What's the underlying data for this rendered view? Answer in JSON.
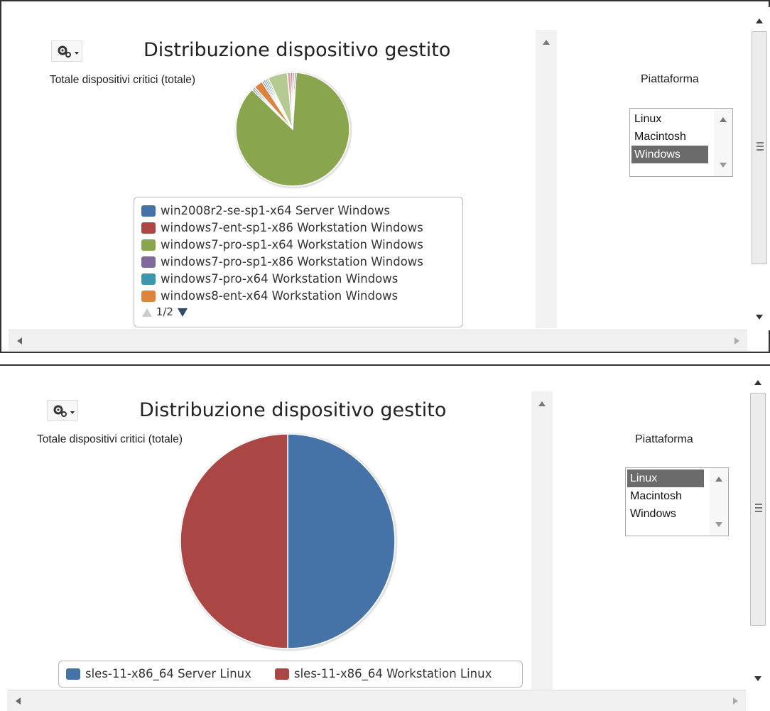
{
  "colors": {
    "blue": "#4572a7",
    "red": "#aa4643",
    "green": "#89a54e",
    "purple": "#80699b",
    "teal": "#3d96ae",
    "orange": "#db843d",
    "light_green": "#b5ca92",
    "light_red": "#d9a3a1",
    "selected_bg": "#6b6b6b"
  },
  "panels": [
    {
      "gear_icon": "gear-icon",
      "title": "Distribuzione dispositivo gestito",
      "subtitle": "Totale dispositivi critici (totale)",
      "legend": {
        "items": [
          {
            "label": "win2008r2-se-sp1-x64 Server Windows",
            "color": "#4572a7"
          },
          {
            "label": "windows7-ent-sp1-x86 Workstation Windows",
            "color": "#aa4643"
          },
          {
            "label": "windows7-pro-sp1-x64 Workstation Windows",
            "color": "#89a54e"
          },
          {
            "label": "windows7-pro-sp1-x86 Workstation Windows",
            "color": "#80699b"
          },
          {
            "label": "windows7-pro-x64 Workstation Windows",
            "color": "#3d96ae"
          },
          {
            "label": "windows8-ent-x64 Workstation Windows",
            "color": "#db843d"
          }
        ],
        "page": "1/2"
      },
      "platform_label": "Piattaforma",
      "platform_options": [
        "Linux",
        "Macintosh",
        "Windows"
      ],
      "platform_selected": "Windows"
    },
    {
      "gear_icon": "gear-icon",
      "title": "Distribuzione dispositivo gestito",
      "subtitle": "Totale dispositivi critici (totale)",
      "legend": {
        "items": [
          {
            "label": "sles-11-x86_64 Server Linux",
            "color": "#4572a7"
          },
          {
            "label": "sles-11-x86_64 Workstation Linux",
            "color": "#aa4643"
          }
        ]
      },
      "platform_label": "Piattaforma",
      "platform_options": [
        "Linux",
        "Macintosh",
        "Windows"
      ],
      "platform_selected": "Linux"
    }
  ],
  "chart_data": [
    {
      "type": "pie",
      "title": "Distribuzione dispositivo gestito",
      "subtitle": "Totale dispositivi critici (totale)",
      "slices": [
        {
          "label": "win2008r2-se-sp1-x64 Server Windows",
          "value": 0.5,
          "color": "#4572a7"
        },
        {
          "label": "windows7-ent-sp1-x86 Workstation Windows",
          "value": 0.5,
          "color": "#aa4643"
        },
        {
          "label": "windows7-pro-sp1-x64 Workstation Windows",
          "value": 85,
          "color": "#89a54e"
        },
        {
          "label": "windows7-pro-sp1-x86 Workstation Windows",
          "value": 0.5,
          "color": "#80699b"
        },
        {
          "label": "windows7-pro-x64 Workstation Windows",
          "value": 0.5,
          "color": "#3d96ae"
        },
        {
          "label": "windows8-ent-x64 Workstation Windows",
          "value": 2.5,
          "color": "#db843d"
        },
        {
          "value": 0.5,
          "color": "#4572a7"
        },
        {
          "value": 0.5,
          "color": "#80699b"
        },
        {
          "value": 0.5,
          "color": "#3d96ae"
        },
        {
          "value": 0.5,
          "color": "#89a54e"
        },
        {
          "value": 5.5,
          "color": "#b5ca92"
        },
        {
          "value": 1.0,
          "color": "#d9a3a1"
        },
        {
          "value": 0.5,
          "color": "#aa4643"
        }
      ],
      "start_angle_deg": 0,
      "legend_position": "bottom"
    },
    {
      "type": "pie",
      "title": "Distribuzione dispositivo gestito",
      "subtitle": "Totale dispositivi critici (totale)",
      "slices": [
        {
          "label": "sles-11-x86_64 Server Linux",
          "value": 1,
          "color": "#4572a7"
        },
        {
          "label": "sles-11-x86_64 Workstation Linux",
          "value": 1,
          "color": "#aa4643"
        }
      ],
      "start_angle_deg": 0,
      "legend_position": "bottom"
    }
  ]
}
